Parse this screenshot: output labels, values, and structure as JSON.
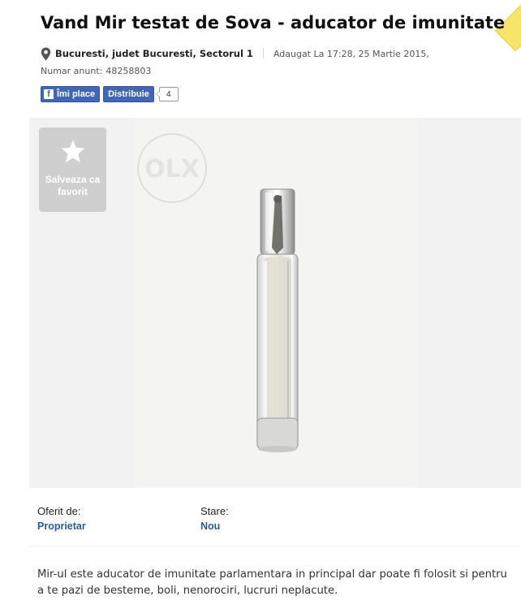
{
  "title": "Vand Mir testat de Sova - aducator de imunitate",
  "location": "Bucuresti, judet Bucuresti, Sectorul 1",
  "added_text": "Adaugat La 17:28, 25 Martie 2015,",
  "ad_id": {
    "label": "Numar anunt:",
    "value": "48258803"
  },
  "social": {
    "like_label": "Îmi place",
    "share_label": "Distribuie",
    "share_count": "4"
  },
  "favorite": {
    "label": "Salveaza ca favorit"
  },
  "photo": {
    "watermark": "OLX"
  },
  "details": [
    {
      "key": "Oferit de:",
      "value": "Proprietar"
    },
    {
      "key": "Stare:",
      "value": "Nou"
    }
  ],
  "description": "Mir-ul este aducator de imunitate parlamentara in principal dar poate fi folosit si pentru a te pazi de besteme, boli, nenorociri, lucruri neplacute.",
  "colors": {
    "link_blue": "#2f5b94",
    "facebook_blue": "#4267b2",
    "favorite_bg": "#cfcfcf",
    "badge_yellow": "#f7e46b"
  },
  "icons": {
    "location": "map-pin-icon",
    "favorite": "star-icon",
    "facebook": "facebook-f-icon"
  }
}
